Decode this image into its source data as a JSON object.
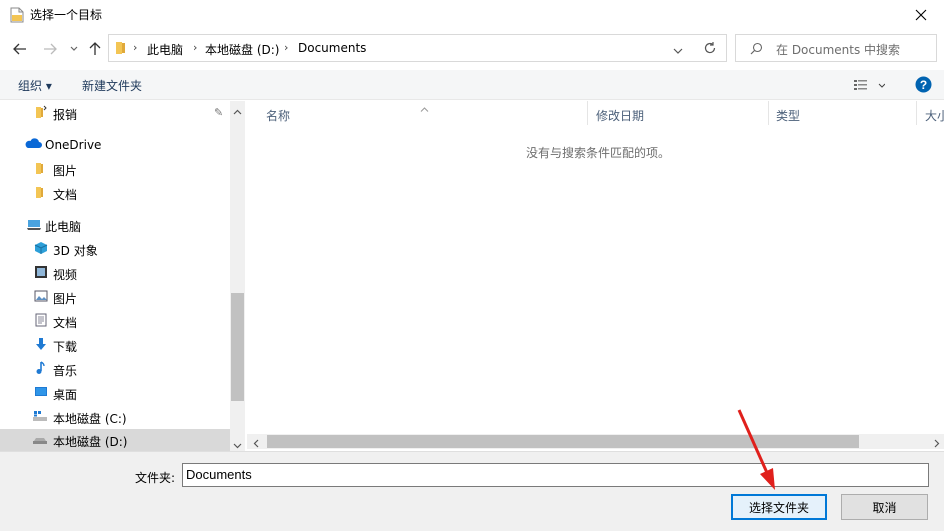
{
  "window": {
    "title": "选择一个目标"
  },
  "nav": {
    "breadcrumb": [
      "此电脑",
      "本地磁盘 (D:)",
      "Documents"
    ],
    "search_placeholder": "在 Documents 中搜索"
  },
  "toolbar": {
    "organize": "组织 ▾",
    "new_folder": "新建文件夹"
  },
  "sidebar": {
    "items": [
      {
        "label": "报销",
        "icon": "folder-icon"
      },
      {
        "label": "OneDrive",
        "icon": "cloud-icon"
      },
      {
        "label": "图片",
        "icon": "folder-icon"
      },
      {
        "label": "文档",
        "icon": "folder-icon"
      },
      {
        "label": "此电脑",
        "icon": "computer-icon"
      },
      {
        "label": "3D 对象",
        "icon": "cube-icon"
      },
      {
        "label": "视频",
        "icon": "video-icon"
      },
      {
        "label": "图片",
        "icon": "pictures-icon"
      },
      {
        "label": "文档",
        "icon": "documents-icon"
      },
      {
        "label": "下载",
        "icon": "download-icon"
      },
      {
        "label": "音乐",
        "icon": "music-icon"
      },
      {
        "label": "桌面",
        "icon": "desktop-icon"
      },
      {
        "label": "本地磁盘 (C:)",
        "icon": "drive-icon"
      },
      {
        "label": "本地磁盘 (D:)",
        "icon": "drive-icon",
        "selected": true
      }
    ]
  },
  "columns": [
    "名称",
    "修改日期",
    "类型",
    "大小"
  ],
  "empty_message": "没有与搜索条件匹配的项。",
  "footer": {
    "folder_label": "文件夹:",
    "folder_value": "Documents",
    "select_button": "选择文件夹",
    "cancel_button": "取消"
  },
  "colors": {
    "accent": "#0078d7",
    "annotation_arrow": "#e0201c"
  }
}
